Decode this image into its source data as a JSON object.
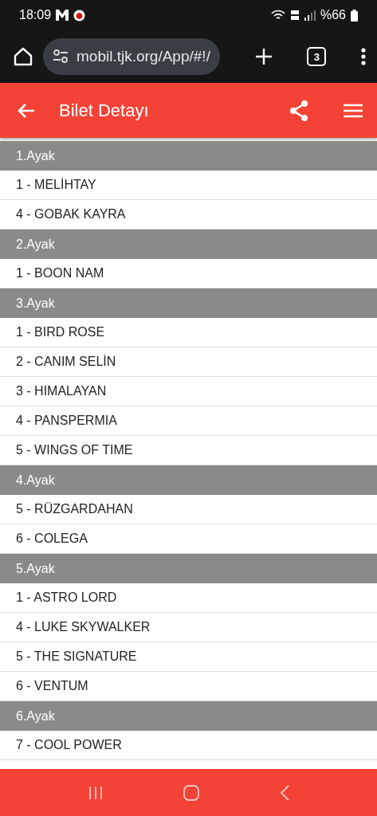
{
  "status_bar": {
    "time": "18:09",
    "battery": "%66"
  },
  "browser": {
    "url": "mobil.tjk.org/App/#!/",
    "tab_count": "3"
  },
  "header": {
    "title": "Bilet Detayı"
  },
  "legs": [
    {
      "title": "1.Ayak",
      "horses": [
        "1 - MELİHTAY",
        "4 - GOBAK KAYRA"
      ]
    },
    {
      "title": "2.Ayak",
      "horses": [
        "1 - BOON NAM"
      ]
    },
    {
      "title": "3.Ayak",
      "horses": [
        "1 - BIRD ROSE",
        "2 - CANIM SELİN",
        "3 - HIMALAYAN",
        "4 - PANSPERMIA",
        "5 - WINGS OF TIME"
      ]
    },
    {
      "title": "4.Ayak",
      "horses": [
        "5 - RÜZGARDAHAN",
        "6 - COLEGA"
      ]
    },
    {
      "title": "5.Ayak",
      "horses": [
        "1 - ASTRO LORD",
        "4 - LUKE SKYWALKER",
        "5 - THE SIGNATURE",
        "6 - VENTUM"
      ]
    },
    {
      "title": "6.Ayak",
      "horses": [
        "7 - COOL POWER"
      ]
    }
  ]
}
